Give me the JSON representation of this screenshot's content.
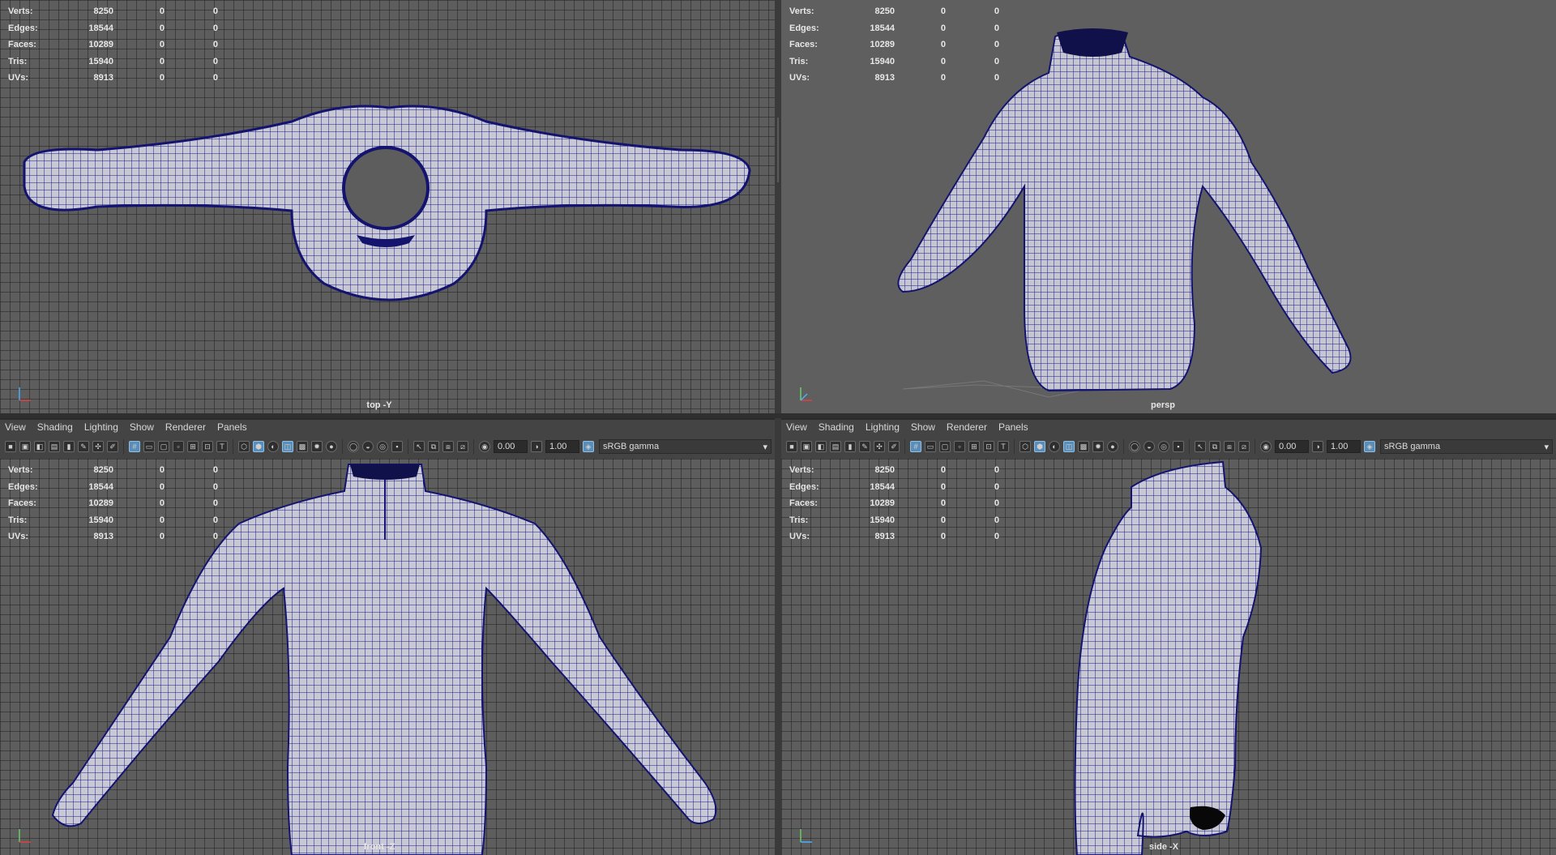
{
  "stats": {
    "rows": [
      {
        "label": "Verts:",
        "v1": "8250",
        "v2": "0",
        "v3": "0"
      },
      {
        "label": "Edges:",
        "v1": "18544",
        "v2": "0",
        "v3": "0"
      },
      {
        "label": "Faces:",
        "v1": "10289",
        "v2": "0",
        "v3": "0"
      },
      {
        "label": "Tris:",
        "v1": "15940",
        "v2": "0",
        "v3": "0"
      },
      {
        "label": "UVs:",
        "v1": "8913",
        "v2": "0",
        "v3": "0"
      }
    ]
  },
  "viewports": {
    "top": {
      "camera": "top -Y"
    },
    "persp": {
      "camera": "persp"
    },
    "front": {
      "camera": "front -Z"
    },
    "side": {
      "camera": "side -X"
    }
  },
  "panel_menu": [
    "View",
    "Shading",
    "Lighting",
    "Show",
    "Renderer",
    "Panels"
  ],
  "toolbar": {
    "exposure": "0.00",
    "gamma": "1.00",
    "colorspace": "sRGB gamma"
  },
  "icons": {
    "camera": "camera-icon",
    "axis": "axis-gizmo-icon",
    "wireframe": "wireframe-icon",
    "shaded": "shaded-icon",
    "dropdown": "chevron-down-icon"
  },
  "colors": {
    "viewport_bg": "#5d5d5d",
    "wireframe": "#1a1a8c",
    "mesh_fill": "#c9c9d6",
    "toolbar_bg": "#444444",
    "active_icon": "#5a8eb8"
  }
}
